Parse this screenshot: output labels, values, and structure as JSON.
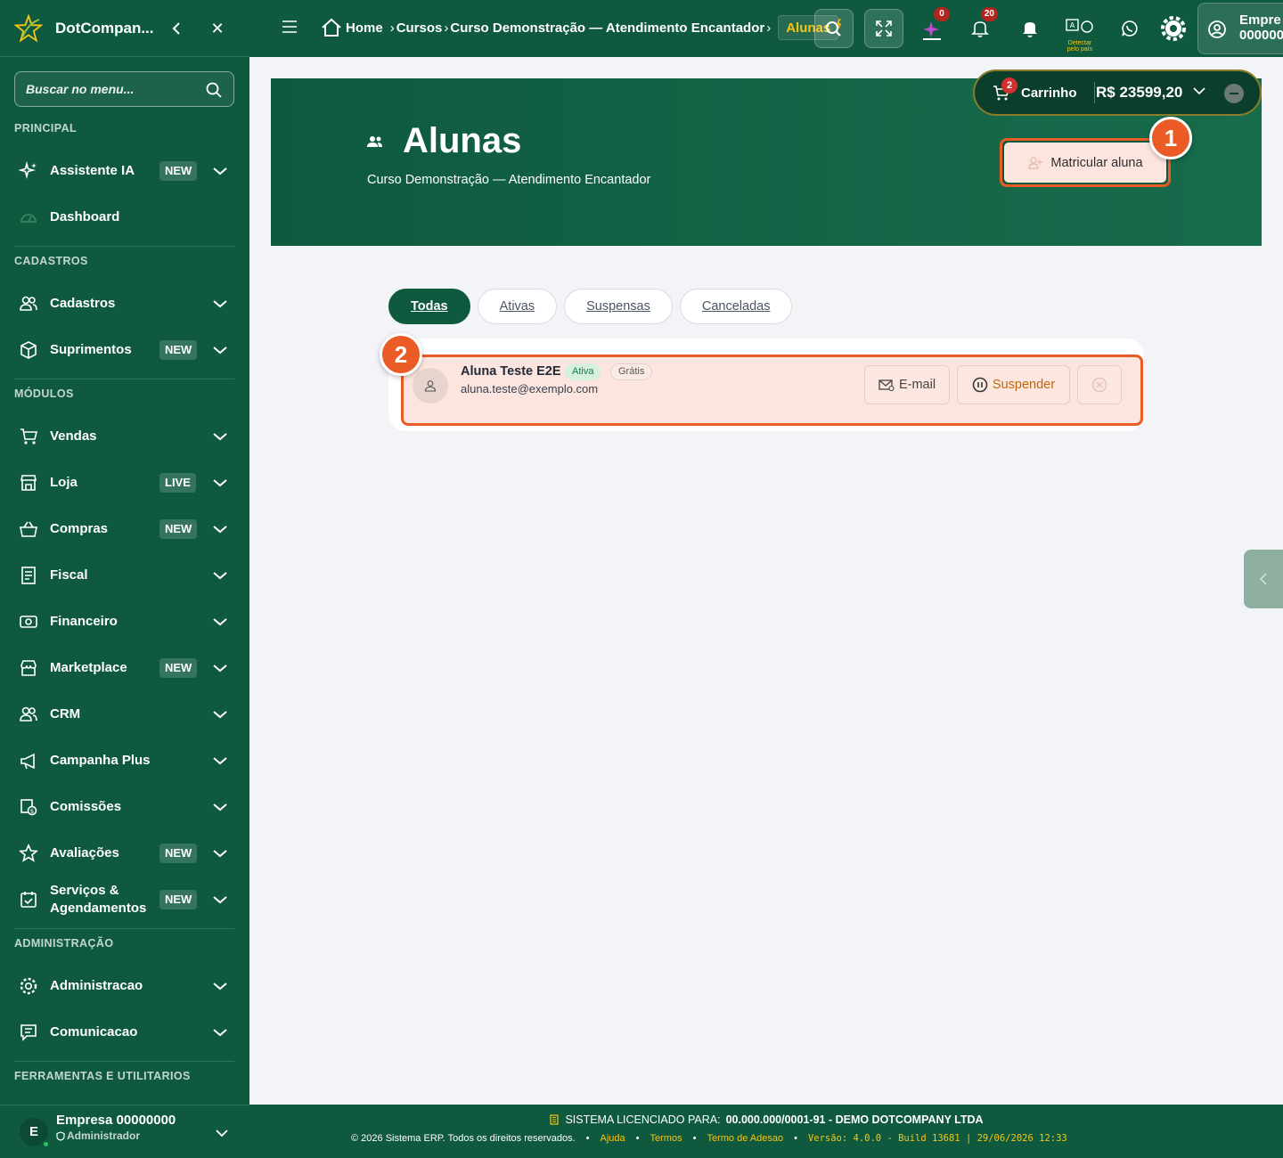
{
  "sidebar": {
    "brand": "DotCompan...",
    "search_placeholder": "Buscar no menu...",
    "sections": {
      "principal": "PRINCIPAL",
      "cadastros": "CADASTROS",
      "modulos": "MÓDULOS",
      "administracao": "ADMINISTRAÇÃO",
      "ferramentas": "FERRAMENTAS E UTILITARIOS"
    },
    "items": {
      "assistente": {
        "label": "Assistente IA",
        "badge": "NEW"
      },
      "dashboard": {
        "label": "Dashboard"
      },
      "cadastros": {
        "label": "Cadastros"
      },
      "suprimentos": {
        "label": "Suprimentos",
        "badge": "NEW"
      },
      "vendas": {
        "label": "Vendas"
      },
      "loja": {
        "label": "Loja",
        "badge": "LIVE"
      },
      "compras": {
        "label": "Compras",
        "badge": "NEW"
      },
      "fiscal": {
        "label": "Fiscal"
      },
      "financeiro": {
        "label": "Financeiro"
      },
      "marketplace": {
        "label": "Marketplace",
        "badge": "NEW"
      },
      "crm": {
        "label": "CRM"
      },
      "campanha": {
        "label": "Campanha Plus"
      },
      "comissoes": {
        "label": "Comissões"
      },
      "avaliacoes": {
        "label": "Avaliações",
        "badge": "NEW"
      },
      "servicos": {
        "label": "Serviços &",
        "label2": "Agendamentos",
        "badge": "NEW"
      },
      "administracao": {
        "label": "Administracao"
      },
      "comunicacao": {
        "label": "Comunicacao"
      }
    },
    "user": {
      "initial": "E",
      "name": "Empresa 00000000",
      "role": "Administrador"
    }
  },
  "topbar": {
    "breadcrumbs": [
      "Home",
      "Cursos",
      "Curso Demonstração — Atendimento Encantador"
    ],
    "current": "Alunas",
    "ai_count": "0",
    "notif_count": "20",
    "detect_label": "Detectar pelo país",
    "company_line1": "Empre",
    "company_line2": "000000"
  },
  "hero": {
    "title": "Alunas",
    "subtitle": "Curso Demonstração — Atendimento Encantador",
    "enroll_button": "Matricular aluna"
  },
  "cart": {
    "count": "2",
    "label": "Carrinho",
    "total": "R$ 23599,20"
  },
  "markers": [
    "1",
    "2"
  ],
  "tabs": [
    "Todas",
    "Ativas",
    "Suspensas",
    "Canceladas"
  ],
  "students": [
    {
      "name": "Aluna Teste E2E",
      "status": "Ativa",
      "type": "Grátis",
      "email": "aluna.teste@exemplo.com"
    }
  ],
  "row_actions": {
    "email": "E-mail",
    "suspend": "Suspender"
  },
  "footer": {
    "license_prefix": "SISTEMA LICENCIADO PARA:",
    "license_holder": "00.000.000/0001-91 - DEMO DOTCOMPANY LTDA",
    "copyright": "© 2026 Sistema ERP. Todos os direitos reservados.",
    "links": [
      "Ajuda",
      "Termos",
      "Termo de Adesao"
    ],
    "version": "Versão: 4.0.0 - Build 13681 | 29/06/2026 12:33"
  },
  "colors": {
    "primary": "#0f5a3f",
    "accent": "#f5c518",
    "highlight": "#ea5b25",
    "danger": "#d32f2f"
  }
}
